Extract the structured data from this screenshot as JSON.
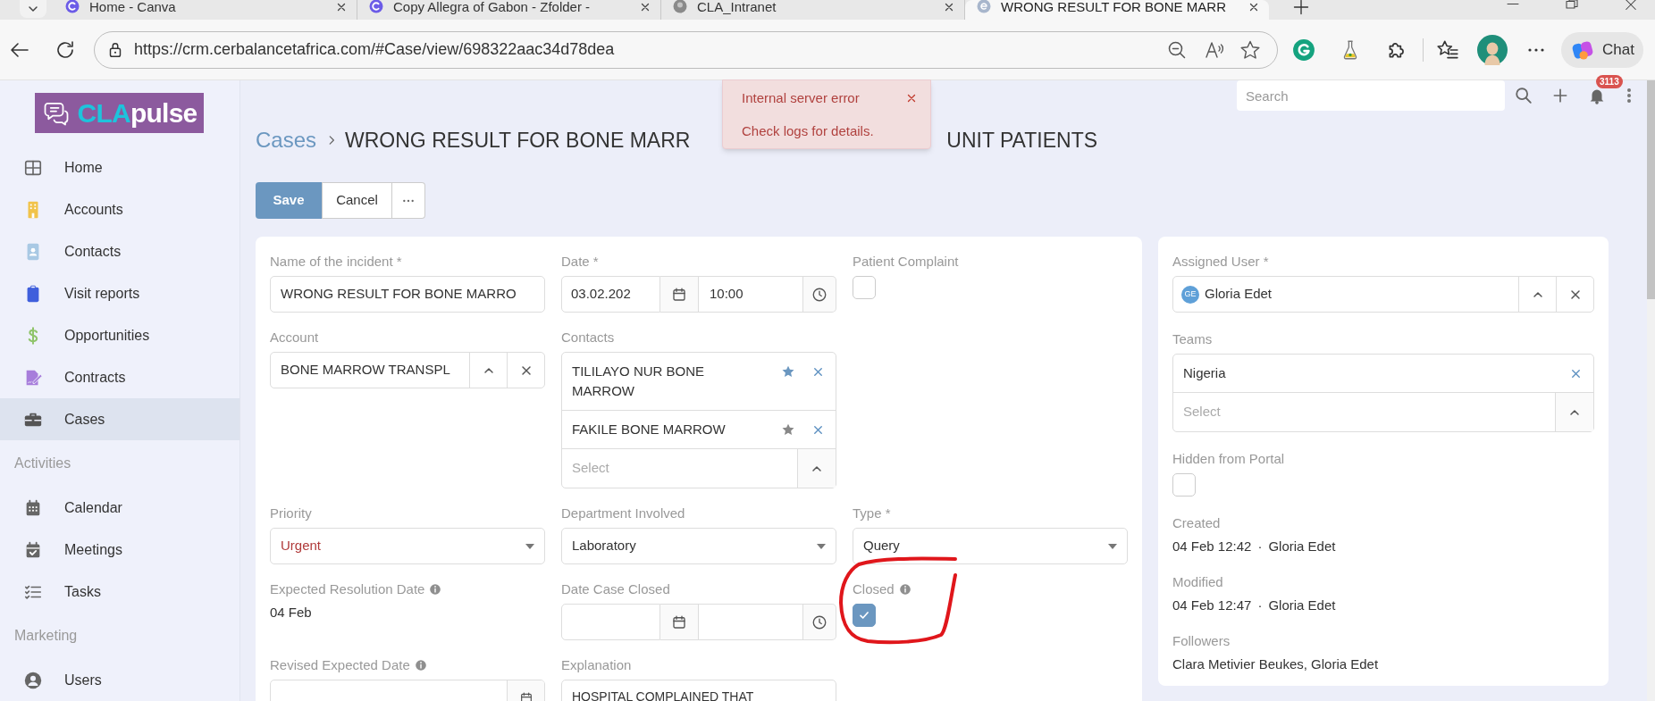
{
  "browser": {
    "tabs": [
      {
        "title": "Home - Canva",
        "selected": false
      },
      {
        "title": "Copy Allegra of Gabon - Zfolder -",
        "selected": false
      },
      {
        "title": "CLA_Intranet",
        "selected": false
      },
      {
        "title": "WRONG RESULT FOR BONE MARR",
        "selected": true
      }
    ],
    "url": "https://crm.cerbalancetafrica.com/#Case/view/698322aac34d78dea",
    "chat_label": "Chat"
  },
  "logo": {
    "accent": "CLA",
    "text": "pulse"
  },
  "sidebar": {
    "items": [
      {
        "kind": "item",
        "label": "Home",
        "selected": false
      },
      {
        "kind": "item",
        "label": "Accounts",
        "selected": false
      },
      {
        "kind": "item",
        "label": "Contacts",
        "selected": false
      },
      {
        "kind": "item",
        "label": "Visit reports",
        "selected": false
      },
      {
        "kind": "item",
        "label": "Opportunities",
        "selected": false
      },
      {
        "kind": "item",
        "label": "Contracts",
        "selected": false
      },
      {
        "kind": "item",
        "label": "Cases",
        "selected": true
      },
      {
        "kind": "section",
        "label": "Activities"
      },
      {
        "kind": "item",
        "label": "Calendar",
        "selected": false
      },
      {
        "kind": "item",
        "label": "Meetings",
        "selected": false
      },
      {
        "kind": "item",
        "label": "Tasks",
        "selected": false
      },
      {
        "kind": "section",
        "label": "Marketing"
      },
      {
        "kind": "item",
        "label": "Users",
        "selected": false
      }
    ]
  },
  "header": {
    "search_placeholder": "Search",
    "notification_count": "3113"
  },
  "toast": {
    "title": "Internal server error",
    "message": "Check logs for details."
  },
  "breadcrumb": {
    "parent": "Cases",
    "title_parts": [
      "WRONG RESULT FOR BONE MARR",
      "UNIT PATIENTS"
    ]
  },
  "buttons": {
    "save": "Save",
    "cancel": "Cancel"
  },
  "form": {
    "rows": [
      [
        {
          "kind": "text",
          "label": "Name of the incident *",
          "value": "WRONG RESULT FOR BONE MARRO"
        },
        {
          "kind": "datetime",
          "label": "Date *",
          "date": "03.02.202",
          "time": "10:00"
        },
        {
          "kind": "checkbox",
          "label": "Patient Complaint",
          "checked": false
        }
      ],
      [
        {
          "kind": "link",
          "label": "Account",
          "value": "BONE MARROW TRANSPL"
        },
        {
          "kind": "link_multiple",
          "label": "Contacts",
          "items": [
            {
              "name": "TILILAYO NUR BONE MARROW",
              "primary": true
            },
            {
              "name": "FAKILE BONE MARROW",
              "primary": false
            }
          ],
          "placeholder": "Select"
        }
      ],
      [
        {
          "kind": "enum",
          "label": "Priority",
          "value": "Urgent",
          "urgent": true
        },
        {
          "kind": "enum",
          "label": "Department Involved",
          "value": "Laboratory",
          "urgent": false
        },
        {
          "kind": "enum",
          "label": "Type *",
          "value": "Query",
          "urgent": false
        }
      ],
      [
        {
          "kind": "static",
          "label": "Expected Resolution Date",
          "info": true,
          "value": "04 Feb"
        },
        {
          "kind": "datetime",
          "label": "Date Case Closed"
        },
        {
          "kind": "checkbox",
          "label": "Closed",
          "info": true,
          "checked": true
        }
      ],
      [
        {
          "kind": "date",
          "label": "Revised Expected Date",
          "info": true
        },
        {
          "kind": "textarea",
          "label": "Explanation",
          "value": "HOSPITAL COMPLAINED THAT"
        }
      ]
    ]
  },
  "side_panel": {
    "fields": [
      {
        "kind": "user",
        "label": "Assigned User *",
        "initials": "GE",
        "value": "Gloria Edet"
      },
      {
        "kind": "link_multiple",
        "label": "Teams",
        "items": [
          {
            "name": "Nigeria"
          }
        ],
        "placeholder": "Select"
      },
      {
        "kind": "checkbox",
        "label": "Hidden from Portal",
        "checked": false
      },
      {
        "kind": "meta",
        "label": "Created",
        "parts": [
          "04 Feb 12:42",
          "·",
          "Gloria Edet"
        ]
      },
      {
        "kind": "meta",
        "label": "Modified",
        "parts": [
          "04 Feb 12:47",
          "·",
          "Gloria Edet"
        ]
      },
      {
        "kind": "static",
        "label": "Followers",
        "value": "Clara Metivier Beukes, Gloria Edet"
      }
    ]
  }
}
